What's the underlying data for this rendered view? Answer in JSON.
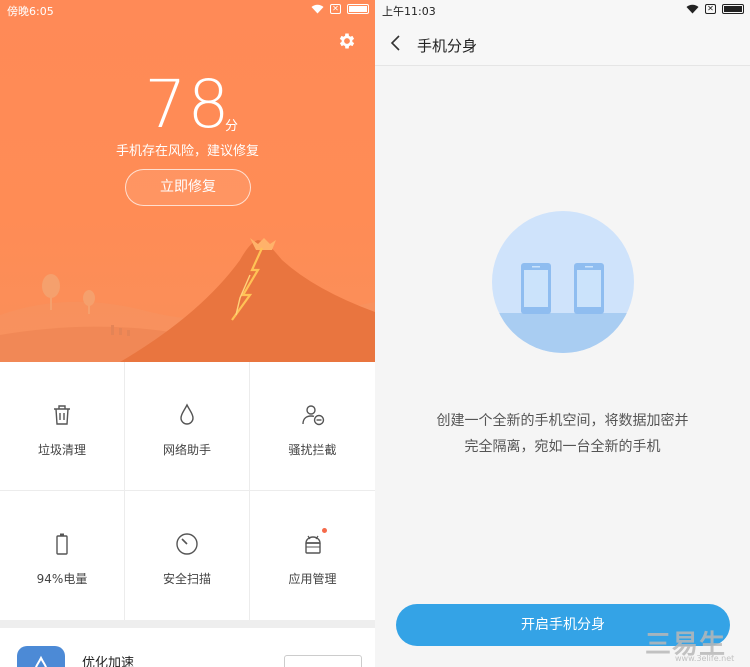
{
  "left": {
    "status": {
      "time": "傍晚6:05"
    },
    "score": {
      "value": "78",
      "unit": "分"
    },
    "risk_text": "手机存在风险，建议修复",
    "fix_button": "立即修复",
    "grid": [
      {
        "label": "垃圾清理",
        "icon": "trash-icon"
      },
      {
        "label": "网络助手",
        "icon": "drop-icon"
      },
      {
        "label": "骚扰拦截",
        "icon": "user-block-icon"
      },
      {
        "label": "94%电量",
        "icon": "battery-icon"
      },
      {
        "label": "安全扫描",
        "icon": "clock-scan-icon"
      },
      {
        "label": "应用管理",
        "icon": "android-icon"
      }
    ],
    "optimize": {
      "title": "优化加速"
    }
  },
  "right": {
    "status": {
      "time": "上午11:03"
    },
    "title": "手机分身",
    "description_line1": "创建一个全新的手机空间，将数据加密并",
    "description_line2": "完全隔离，宛如一台全新的手机",
    "cta": "开启手机分身",
    "watermark": "三易生活",
    "watermark_url": "www.3elife.net"
  },
  "colors": {
    "hero_orange": "#ff8a57",
    "cta_blue": "#34a3e6",
    "illus_blue": "#bcdaf7"
  }
}
